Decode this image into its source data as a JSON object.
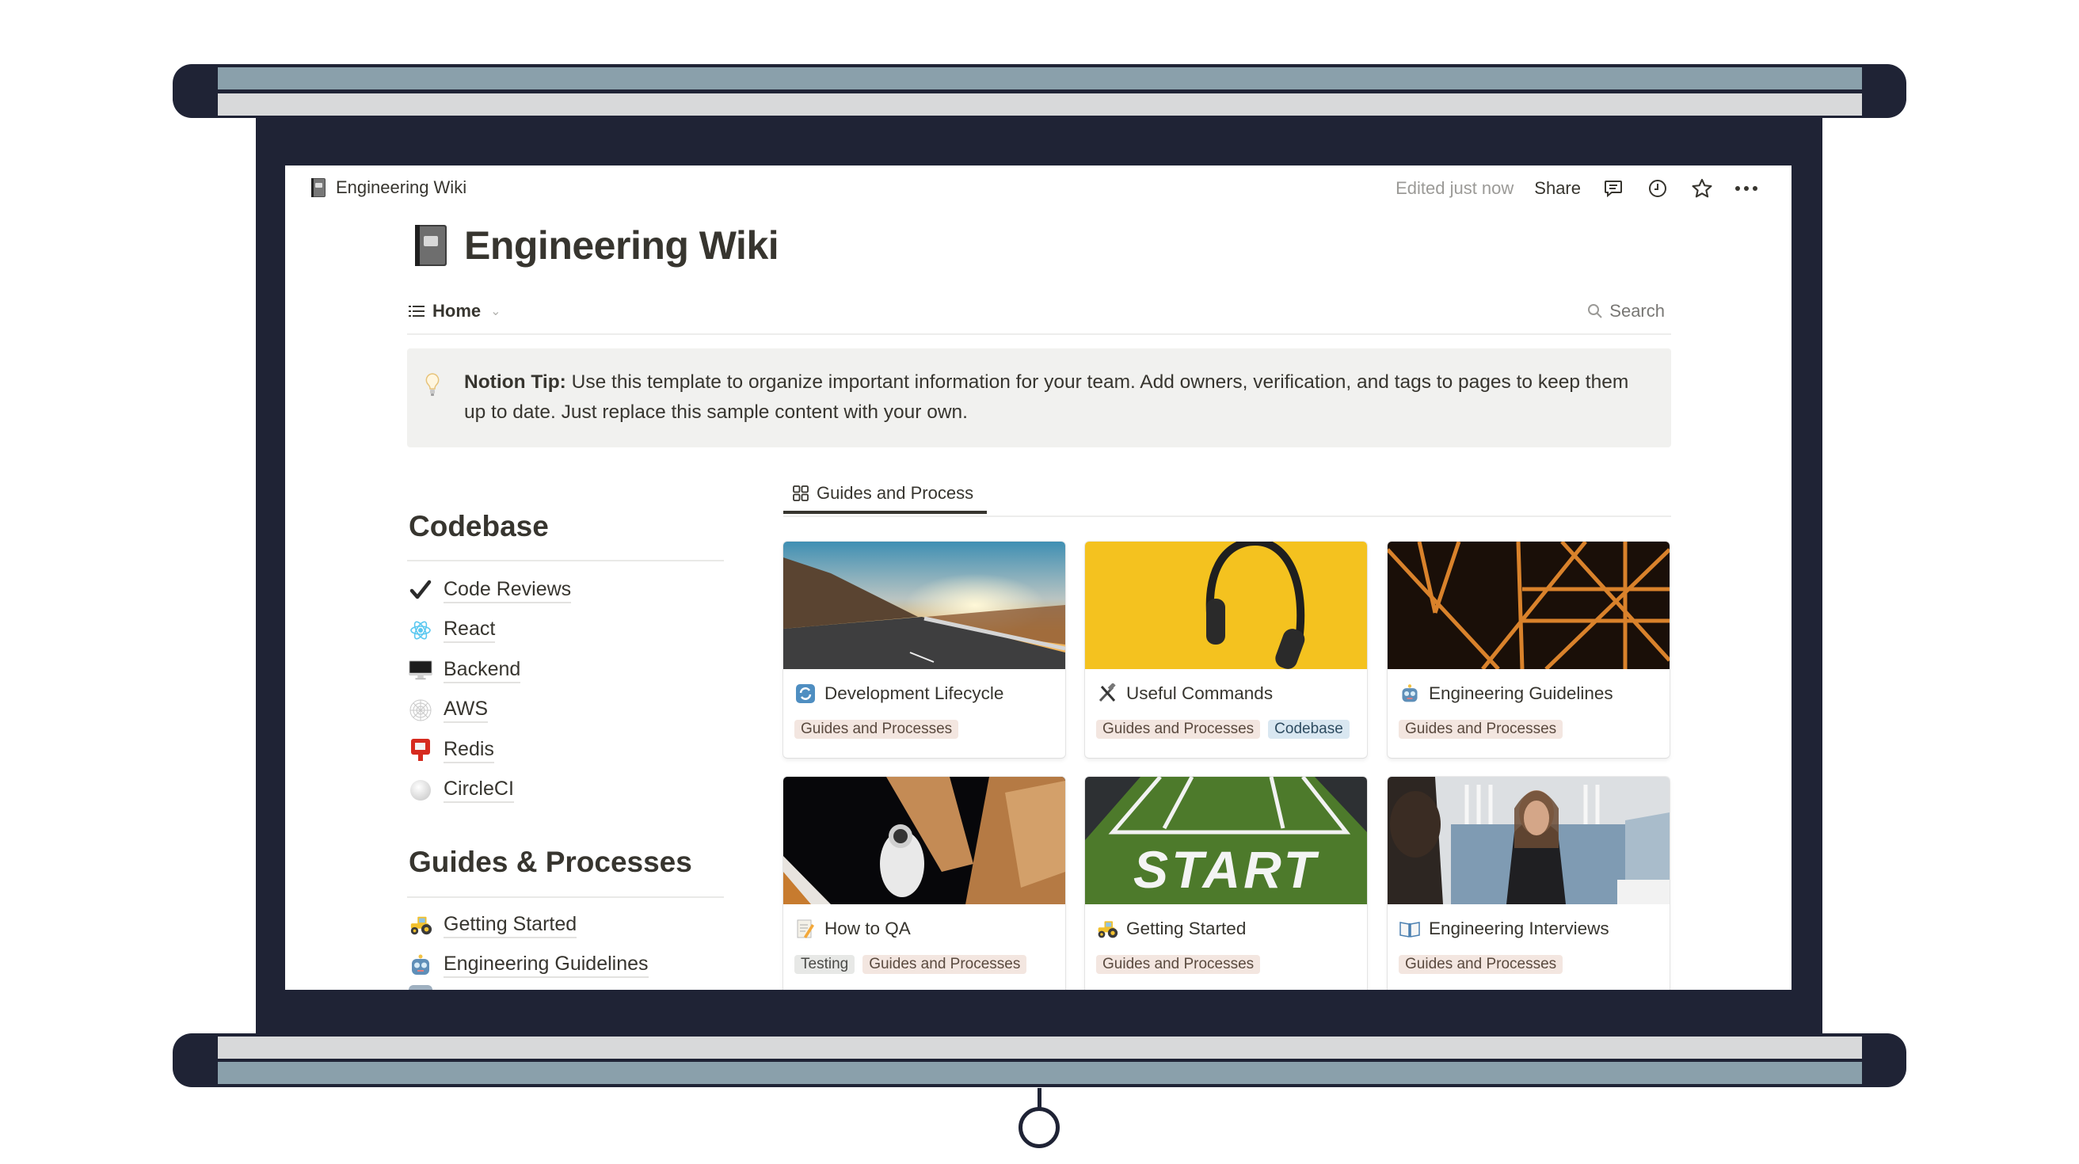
{
  "topbar": {
    "breadcrumb": "Engineering Wiki",
    "breadcrumb_icon": "composition-notebook-icon",
    "edited": "Edited just now",
    "share": "Share",
    "icons": [
      "comment-icon",
      "history-clock-icon",
      "favorite-star-icon",
      "more-dots-icon"
    ]
  },
  "page": {
    "title": "Engineering Wiki",
    "icon": "composition-notebook-icon"
  },
  "view_bar": {
    "home_tab": "Home",
    "search": "Search"
  },
  "callout": {
    "icon": "lightbulb-icon",
    "bold": "Notion Tip:",
    "text": " Use this template to organize important information for your team. Add owners, verification, and tags to pages to keep them up to date. Just replace this sample content with your own."
  },
  "sections": [
    {
      "heading": "Codebase",
      "items": [
        {
          "label": "Code Reviews",
          "icon": "check-mark-icon"
        },
        {
          "label": "React",
          "icon": "atom-icon"
        },
        {
          "label": "Backend",
          "icon": "desktop-computer-icon"
        },
        {
          "label": "AWS",
          "icon": "spider-web-icon"
        },
        {
          "label": "Redis",
          "icon": "red-sign-icon"
        },
        {
          "label": "CircleCI",
          "icon": "white-circle-icon"
        }
      ]
    },
    {
      "heading": "Guides & Processes",
      "items": [
        {
          "label": "Getting Started",
          "icon": "tractor-icon"
        },
        {
          "label": "Engineering Guidelines",
          "icon": "robot-icon"
        }
      ]
    }
  ],
  "gallery": {
    "tab": "Guides and Process",
    "tab_icon": "gallery-grid-icon",
    "cards": [
      {
        "title": "Development Lifecycle",
        "icon": "repeat-arrows-icon",
        "cover": "mountain-road-sunset",
        "tags": [
          "Guides and Processes"
        ]
      },
      {
        "title": "Useful Commands",
        "icon": "hammer-wrench-icon",
        "cover": "headphones-yellow",
        "tags": [
          "Guides and Processes",
          "Codebase"
        ]
      },
      {
        "title": "Engineering Guidelines",
        "icon": "robot-icon",
        "cover": "orange-steel-structure",
        "tags": [
          "Guides and Processes"
        ]
      },
      {
        "title": "How to QA",
        "icon": "memo-pencil-icon",
        "cover": "astronaut-space-station",
        "tags": [
          "Testing",
          "Guides and Processes"
        ]
      },
      {
        "title": "Getting Started",
        "icon": "tractor-icon",
        "cover": "start-turf",
        "tags": [
          "Guides and Processes"
        ]
      },
      {
        "title": "Engineering Interviews",
        "icon": "open-book-icon",
        "cover": "interview-couch",
        "tags": [
          "Guides and Processes"
        ]
      }
    ]
  },
  "colors": {
    "frame": "#1f2335",
    "strip_blue": "#8aa0ab",
    "strip_gray": "#d8d9da",
    "text": "#37352f",
    "muted": "#9b9a97",
    "callout_bg": "#f1f1ef",
    "tag_guides": "#f3e6e0",
    "tag_codebase": "#d9e7f1",
    "tag_testing": "#e7e8e6"
  }
}
